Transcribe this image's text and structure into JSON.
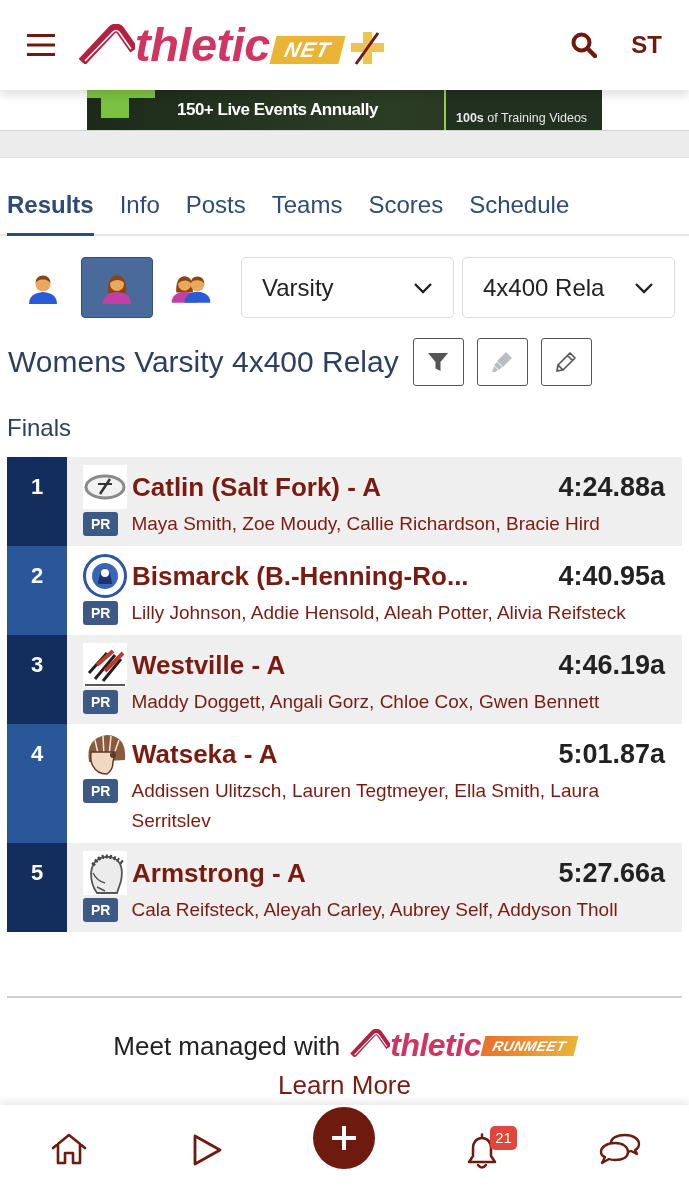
{
  "header": {
    "logo": {
      "wordmark": "thletic",
      "badge": "NET"
    },
    "account": "ST"
  },
  "banner": {
    "headline": "150+ Live Events Annually",
    "panel_text": "**100s** of Training Videos"
  },
  "tabs": [
    {
      "label": "Results",
      "selected": true
    },
    {
      "label": "Info",
      "selected": false
    },
    {
      "label": "Posts",
      "selected": false
    },
    {
      "label": "Teams",
      "selected": false
    },
    {
      "label": "Scores",
      "selected": false
    },
    {
      "label": "Schedule",
      "selected": false
    }
  ],
  "filters": {
    "genders": [
      {
        "kind": "male",
        "selected": false
      },
      {
        "kind": "female",
        "selected": true
      },
      {
        "kind": "both",
        "selected": false
      }
    ],
    "selects": [
      {
        "value": "Varsity"
      },
      {
        "value": "4x400 Rela"
      }
    ]
  },
  "event": {
    "title": "Womens Varsity 4x400 Relay",
    "tools": [
      {
        "kind": "filter"
      },
      {
        "kind": "highlighter"
      },
      {
        "kind": "edit"
      }
    ]
  },
  "section": {
    "title": "Finals"
  },
  "results": [
    {
      "place": "1",
      "team": "Catlin (Salt Fork) - A",
      "time": "4:24.88a",
      "badge": "PR",
      "athletes": "Maya Smith, Zoe Moudy, Callie Richardson, Bracie Hird"
    },
    {
      "place": "2",
      "team": "Bismarck (B.-Henning-Ro...",
      "time": "4:40.95a",
      "badge": "PR",
      "athletes": "Lilly Johnson, Addie Hensold, Aleah Potter, Alivia Reifsteck"
    },
    {
      "place": "3",
      "team": "Westville - A",
      "time": "4:46.19a",
      "badge": "PR",
      "athletes": "Maddy Doggett, Angali Gorz, Chloe Cox, Gwen Bennett"
    },
    {
      "place": "4",
      "team": "Watseka - A",
      "time": "5:01.87a",
      "badge": "PR",
      "athletes": "Addissen Ulitzsch, Lauren Tegtmeyer, Ella Smith, Laura Serritslev"
    },
    {
      "place": "5",
      "team": "Armstrong - A",
      "time": "5:27.66a",
      "badge": "PR",
      "athletes": "Cala Reifsteck, Aleyah Carley, Aubrey Self, Addyson Tholl"
    }
  ],
  "footer": {
    "text": "Meet managed with",
    "logo": {
      "wordmark": "thletic",
      "badge": "RUNMEET"
    },
    "link": "Learn More"
  },
  "bottom_nav": [
    {
      "kind": "home"
    },
    {
      "kind": "play"
    },
    {
      "kind": "add"
    },
    {
      "kind": "notifications",
      "badge": "21"
    },
    {
      "kind": "messages"
    }
  ]
}
